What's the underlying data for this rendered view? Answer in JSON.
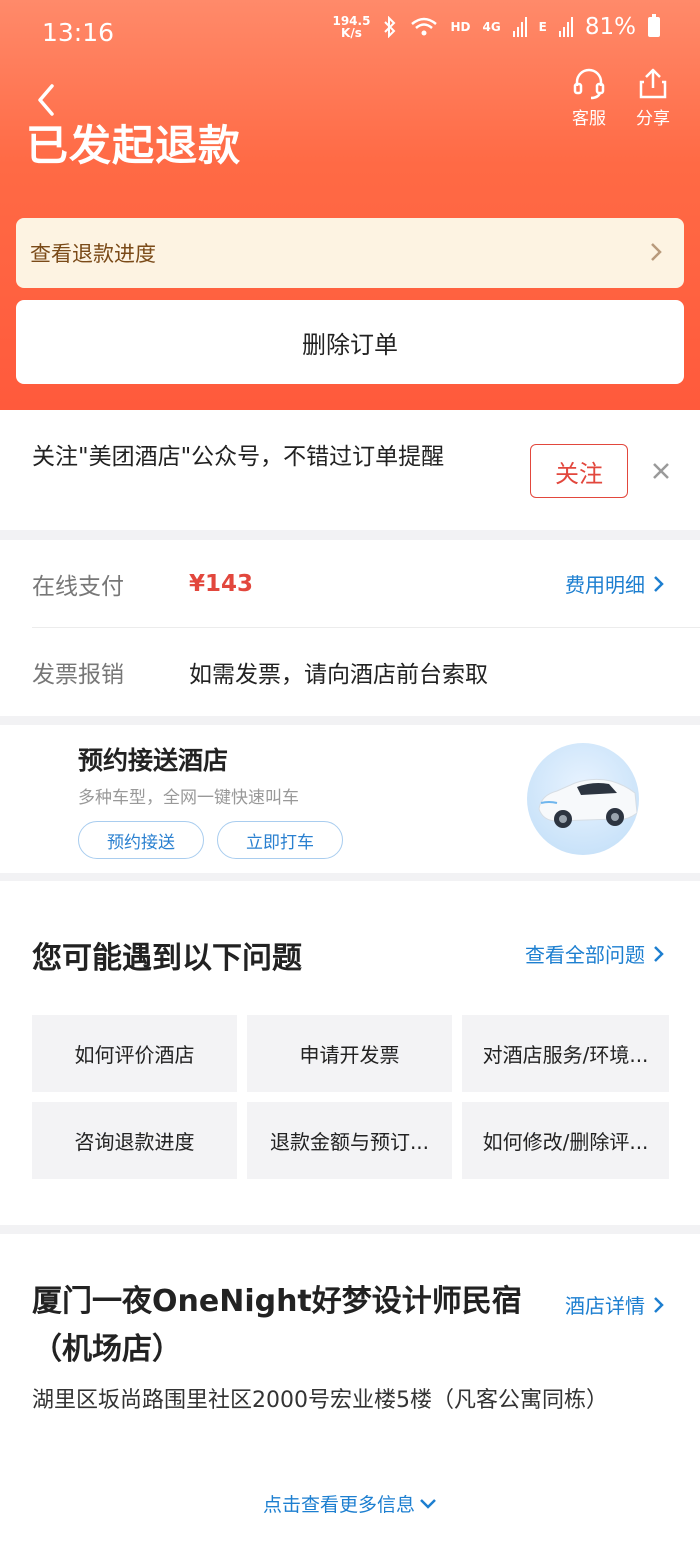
{
  "status_bar": {
    "time": "13:16",
    "net_speed_value": "194.5",
    "net_speed_unit": "K/s",
    "hd": "HD",
    "signal_1": "4G",
    "signal_2": "E",
    "battery": "81%"
  },
  "header": {
    "title": "已发起退款",
    "actions": [
      {
        "label": "客服",
        "icon": "headset-icon"
      },
      {
        "label": "分享",
        "icon": "share-icon"
      }
    ],
    "colors": {
      "gradient_top": "#ff8a6a",
      "gradient_bottom": "#ff5a3c"
    }
  },
  "refund_progress": {
    "label": "查看退款进度"
  },
  "delete_order": {
    "label": "删除订单"
  },
  "follow_banner": {
    "text": "关注\"美团酒店\"公众号，不错过订单提醒",
    "button": "关注"
  },
  "payment": {
    "online_label": "在线支付",
    "amount": "¥143",
    "detail_link": "费用明细",
    "invoice_label": "发票报销",
    "invoice_text": "如需发票，请向酒店前台索取"
  },
  "transfer": {
    "title": "预约接送酒店",
    "subtitle": "多种车型，全网一键快速叫车",
    "buttons": [
      "预约接送",
      "立即打车"
    ]
  },
  "faq": {
    "title": "您可能遇到以下问题",
    "link": "查看全部问题",
    "items": [
      "如何评价酒店",
      "申请开发票",
      "对酒店服务/环境...",
      "咨询退款进度",
      "退款金额与预订...",
      "如何修改/删除评..."
    ]
  },
  "hotel": {
    "name": "厦门一夜OneNight好梦设计师民宿（机场店）",
    "detail_link": "酒店详情",
    "address": "湖里区坂尚路围里社区2000号宏业楼5楼（凡客公寓同栋）",
    "more_info": "点击查看更多信息"
  },
  "colors": {
    "accent_red": "#e2473d",
    "link_blue": "#1d7fd0"
  }
}
